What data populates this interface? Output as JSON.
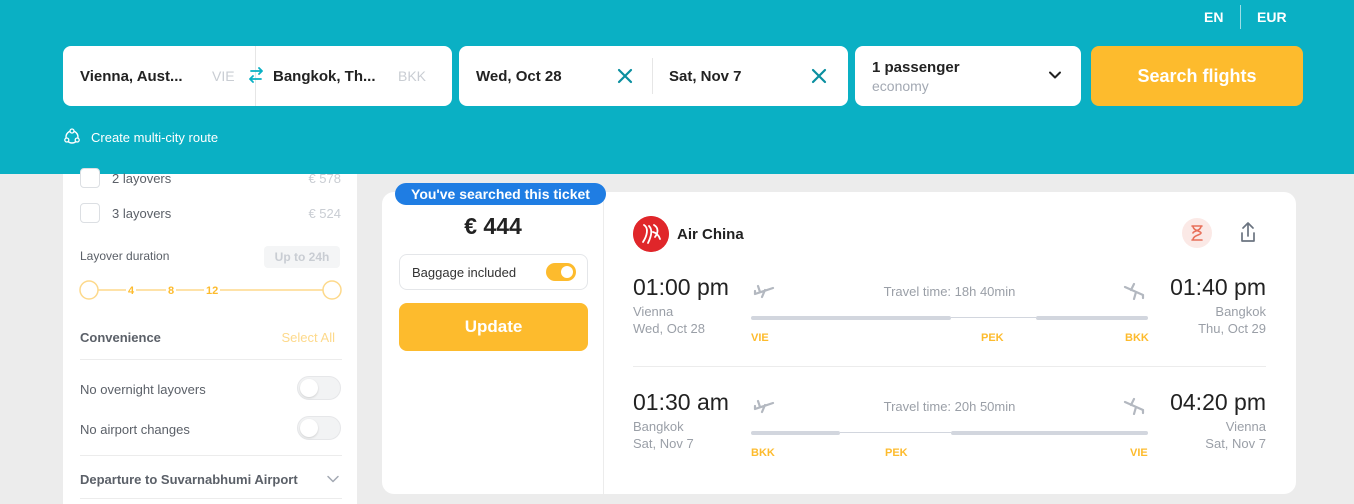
{
  "header": {
    "lang": "EN",
    "currency": "EUR",
    "origin": {
      "city": "Vienna, Aust...",
      "code": "VIE"
    },
    "destination": {
      "city": "Bangkok, Th...",
      "code": "BKK"
    },
    "depart_date": "Wed, Oct 28",
    "return_date": "Sat, Nov 7",
    "passengers": "1 passenger",
    "cabin": "economy",
    "search_label": "Search flights",
    "multicity_label": "Create multi-city route"
  },
  "sidebar": {
    "stops": [
      {
        "label": "2 layovers",
        "price": "€ 578"
      },
      {
        "label": "3 layovers",
        "price": "€ 524"
      }
    ],
    "layover_duration": {
      "title": "Layover duration",
      "value": "Up to 24h",
      "ticks": [
        "4",
        "8",
        "12"
      ]
    },
    "convenience": {
      "title": "Convenience",
      "select_all": "Select All"
    },
    "options": [
      {
        "label": "No overnight layovers"
      },
      {
        "label": "No airport changes"
      }
    ],
    "departure_section": "Departure to Suvarnabhumi Airport"
  },
  "ticket": {
    "badge": "You've searched this ticket",
    "price": "€ 444",
    "baggage_label": "Baggage included",
    "update_label": "Update",
    "airline": "Air China",
    "segments": [
      {
        "dep_time": "01:00 pm",
        "dep_city": "Vienna",
        "dep_date": "Wed, Oct 28",
        "arr_time": "01:40 pm",
        "arr_city": "Bangkok",
        "arr_date": "Thu, Oct 29",
        "travel_time": "Travel time: 18h 40min",
        "codes": [
          "VIE",
          "PEK",
          "BKK"
        ]
      },
      {
        "dep_time": "01:30 am",
        "dep_city": "Bangkok",
        "dep_date": "Sat, Nov 7",
        "arr_time": "04:20 pm",
        "arr_city": "Vienna",
        "arr_date": "Sat, Nov 7",
        "travel_time": "Travel time: 20h 50min",
        "codes": [
          "BKK",
          "PEK",
          "VIE"
        ]
      }
    ]
  },
  "colors": {
    "header": "#0ab0c4",
    "accent": "#fdbb2d",
    "badge": "#1f7de3",
    "airline": "#e0262a"
  }
}
